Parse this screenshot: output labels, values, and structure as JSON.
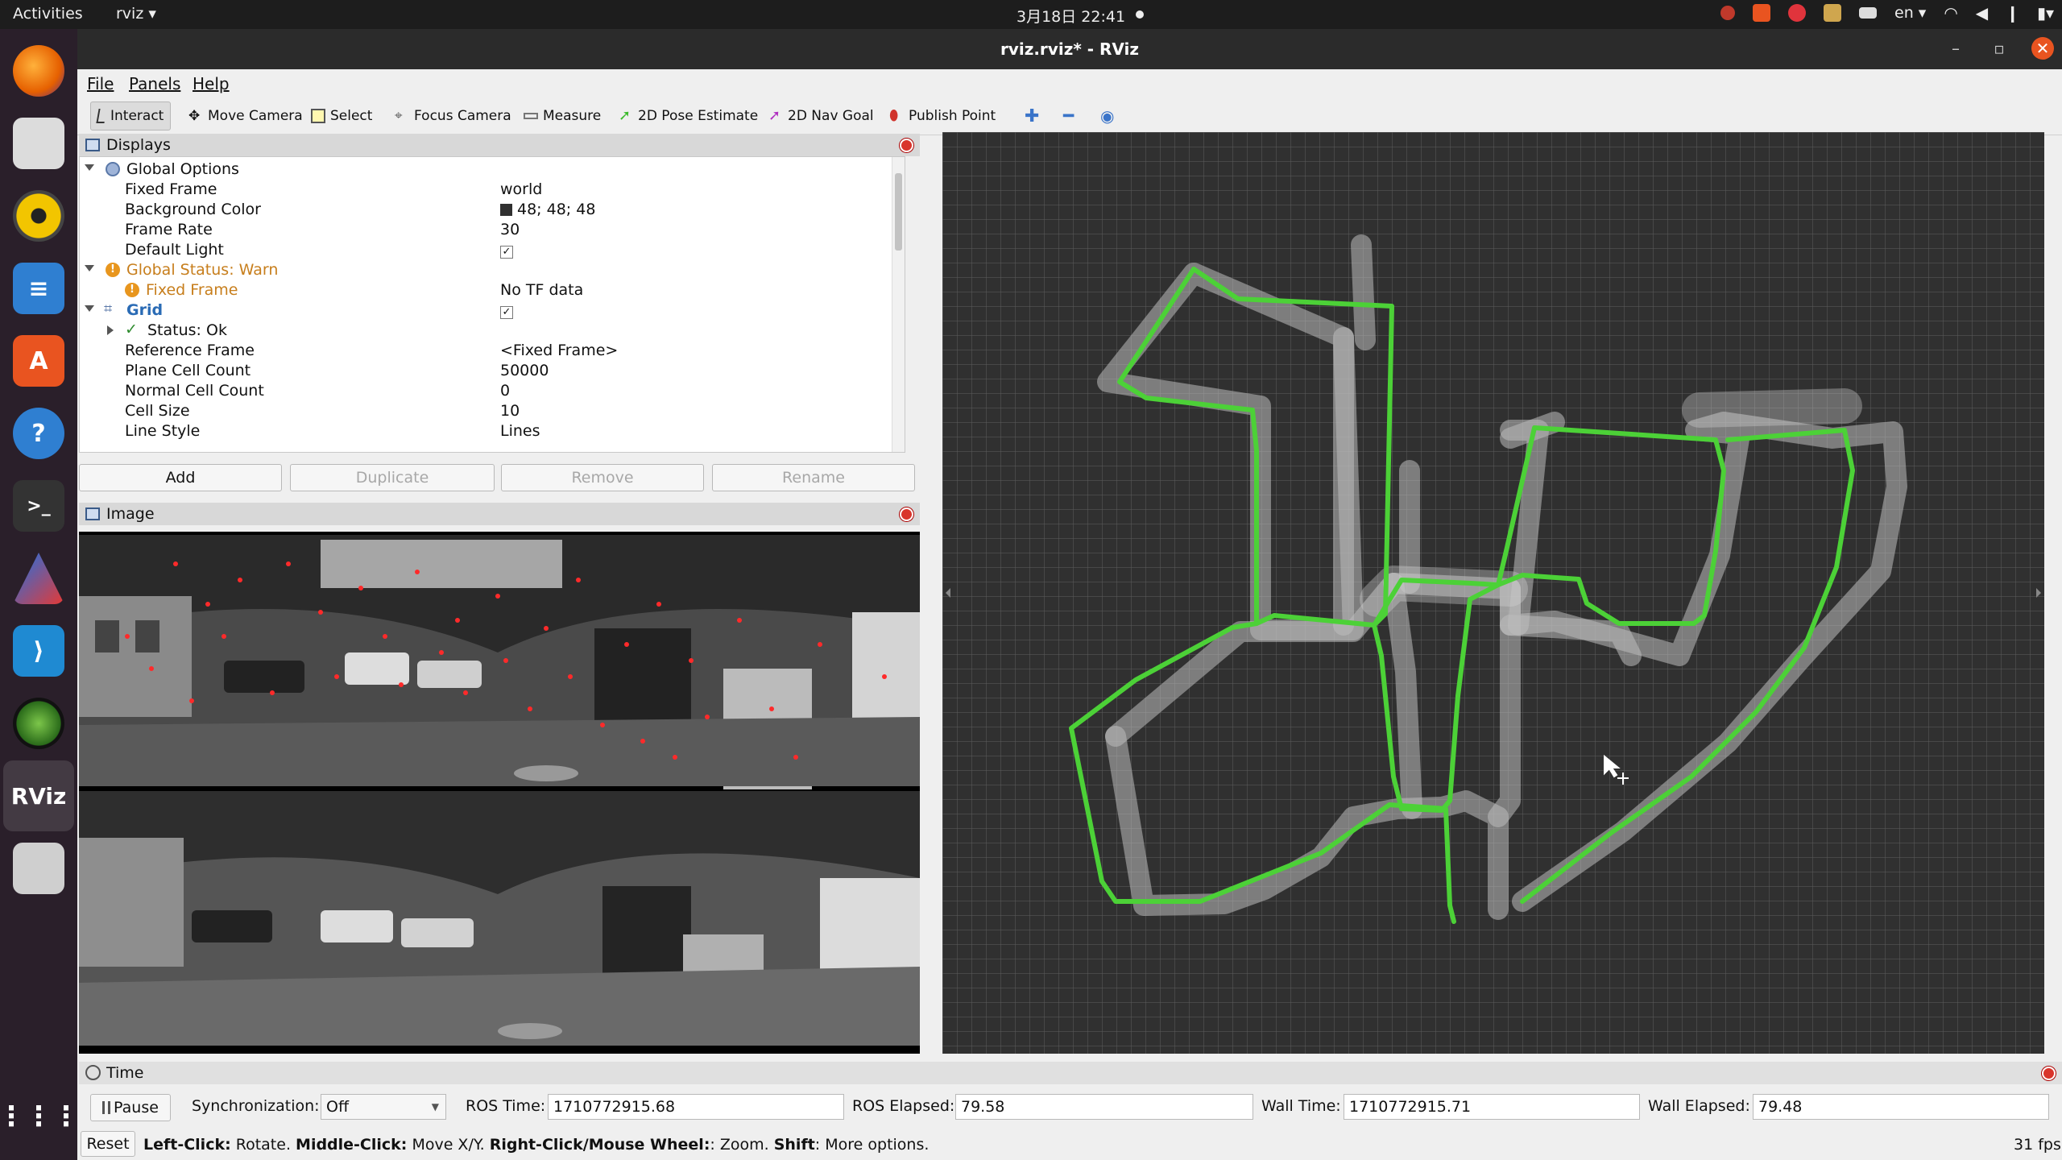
{
  "topbar": {
    "activities": "Activities",
    "app_name": "rviz ▾",
    "clock": "3月18日  22:41",
    "language": "en ▾"
  },
  "window": {
    "title": "rviz.rviz* - RViz"
  },
  "menu": [
    "File",
    "Panels",
    "Help"
  ],
  "toolbar": {
    "interact": "Interact",
    "move_camera": "Move Camera",
    "select": "Select",
    "focus_camera": "Focus Camera",
    "measure": "Measure",
    "pose_estimate": "2D Pose Estimate",
    "nav_goal": "2D Nav Goal",
    "publish_point": "Publish Point"
  },
  "displays": {
    "title": "Displays",
    "rows": [
      {
        "key": "Global Options",
        "value": ""
      },
      {
        "key": "Fixed Frame",
        "value": "world"
      },
      {
        "key": "Background Color",
        "value": "48; 48; 48"
      },
      {
        "key": "Frame Rate",
        "value": "30"
      },
      {
        "key": "Default Light",
        "value": "✓"
      },
      {
        "key": "Global Status: Warn",
        "value": ""
      },
      {
        "key": "Fixed Frame",
        "value": "No TF data"
      },
      {
        "key": "Grid",
        "value": "✓"
      },
      {
        "key": "Status: Ok",
        "value": ""
      },
      {
        "key": "Reference Frame",
        "value": "<Fixed Frame>"
      },
      {
        "key": "Plane Cell Count",
        "value": "50000"
      },
      {
        "key": "Normal Cell Count",
        "value": "0"
      },
      {
        "key": "Cell Size",
        "value": "10"
      },
      {
        "key": "Line Style",
        "value": "Lines"
      }
    ],
    "buttons": {
      "add": "Add",
      "duplicate": "Duplicate",
      "remove": "Remove",
      "rename": "Rename"
    }
  },
  "image_panel": {
    "title": "Image"
  },
  "time_panel": {
    "title": "Time",
    "pause": "Pause",
    "sync_label": "Synchronization:",
    "sync_value": "Off",
    "ros_time_label": "ROS Time:",
    "ros_time": "1710772915.68",
    "ros_elapsed_label": "ROS Elapsed:",
    "ros_elapsed": "79.58",
    "wall_time_label": "Wall Time:",
    "wall_time": "1710772915.71",
    "wall_elapsed_label": "Wall Elapsed:",
    "wall_elapsed": "79.48"
  },
  "statusbar": {
    "reset": "Reset",
    "h1": "Left-Click:",
    "h2": " Rotate. ",
    "h3": "Middle-Click:",
    "h4": " Move X/Y. ",
    "h5": "Right-Click/Mouse Wheel:",
    "h6": ": Zoom. ",
    "h7": "Shift",
    "h8": ": More options.",
    "fps": "31 fps"
  },
  "colors": {
    "background": "#303030",
    "path": "#4cd137",
    "ubuntu_accent": "#e95420"
  }
}
